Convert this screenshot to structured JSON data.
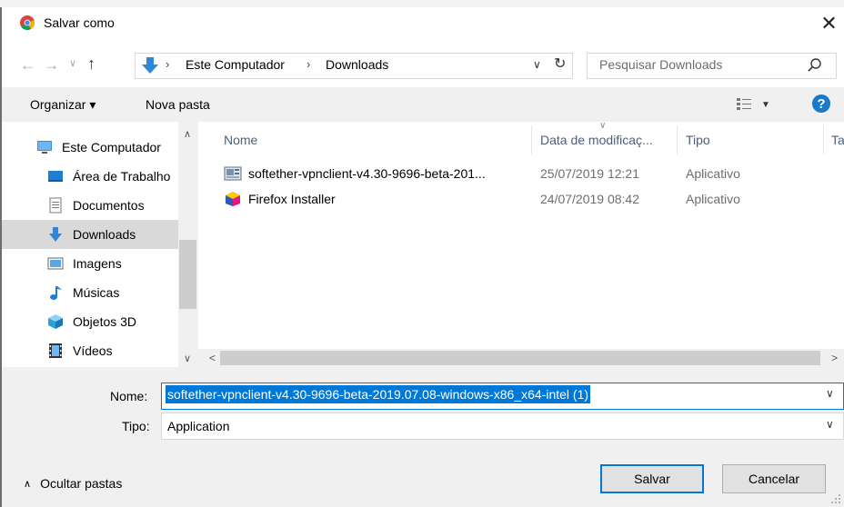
{
  "window": {
    "title": "Salvar como",
    "close_glyph": "✕",
    "app_icon": "chrome-icon"
  },
  "address": {
    "back_glyph": "←",
    "forward_glyph": "→",
    "recent_glyph": "∨",
    "up_glyph": "↑",
    "location_icon": "downloads-arrow-icon",
    "separator": "›",
    "breadcrumbs": [
      "Este Computador",
      "Downloads"
    ],
    "dropdown_glyph": "∨",
    "refresh_glyph": "↻"
  },
  "search": {
    "placeholder": "Pesquisar Downloads",
    "icon": "search-icon"
  },
  "toolbar": {
    "organize_label": "Organizar ▾",
    "new_folder_label": "Nova pasta",
    "view_caret": "▼",
    "help_glyph": "?"
  },
  "nav": {
    "scroll_up": "∧",
    "scroll_down": "∨",
    "items": [
      {
        "label": "Este Computador",
        "icon": "computer-icon"
      },
      {
        "label": "Área de Trabalho",
        "icon": "desktop-icon"
      },
      {
        "label": "Documentos",
        "icon": "documents-icon"
      },
      {
        "label": "Downloads",
        "icon": "downloads-icon",
        "selected": true
      },
      {
        "label": "Imagens",
        "icon": "pictures-icon"
      },
      {
        "label": "Músicas",
        "icon": "music-icon"
      },
      {
        "label": "Objetos 3D",
        "icon": "3d-objects-icon"
      },
      {
        "label": "Vídeos",
        "icon": "videos-icon"
      }
    ]
  },
  "files": {
    "sort_glyph": "∨",
    "columns": [
      "Nome",
      "Data de modificaç...",
      "Tipo",
      "Ta"
    ],
    "rows": [
      {
        "name": "softether-vpnclient-v4.30-9696-beta-201...",
        "date": "25/07/2019 12:21",
        "type": "Aplicativo",
        "icon": "installer-icon"
      },
      {
        "name": "Firefox Installer",
        "date": "24/07/2019 08:42",
        "type": "Aplicativo",
        "icon": "firefox-icon"
      }
    ],
    "hscroll_left": "<",
    "hscroll_right": ">"
  },
  "form": {
    "name_label": "Nome:",
    "name_value": "softether-vpnclient-v4.30-9696-beta-2019.07.08-windows-x86_x64-intel (1)",
    "type_label": "Tipo:",
    "type_value": "Application",
    "dropdown_glyph": "∨"
  },
  "footer": {
    "hide_folders_caret": "∧",
    "hide_folders_label": "Ocultar pastas",
    "save_label": "Salvar",
    "cancel_label": "Cancelar"
  },
  "colors": {
    "accent": "#0078d7",
    "selected_bg": "#d9d9d9",
    "panel_bg": "#f0f0f0",
    "header_text": "#4c607a"
  }
}
